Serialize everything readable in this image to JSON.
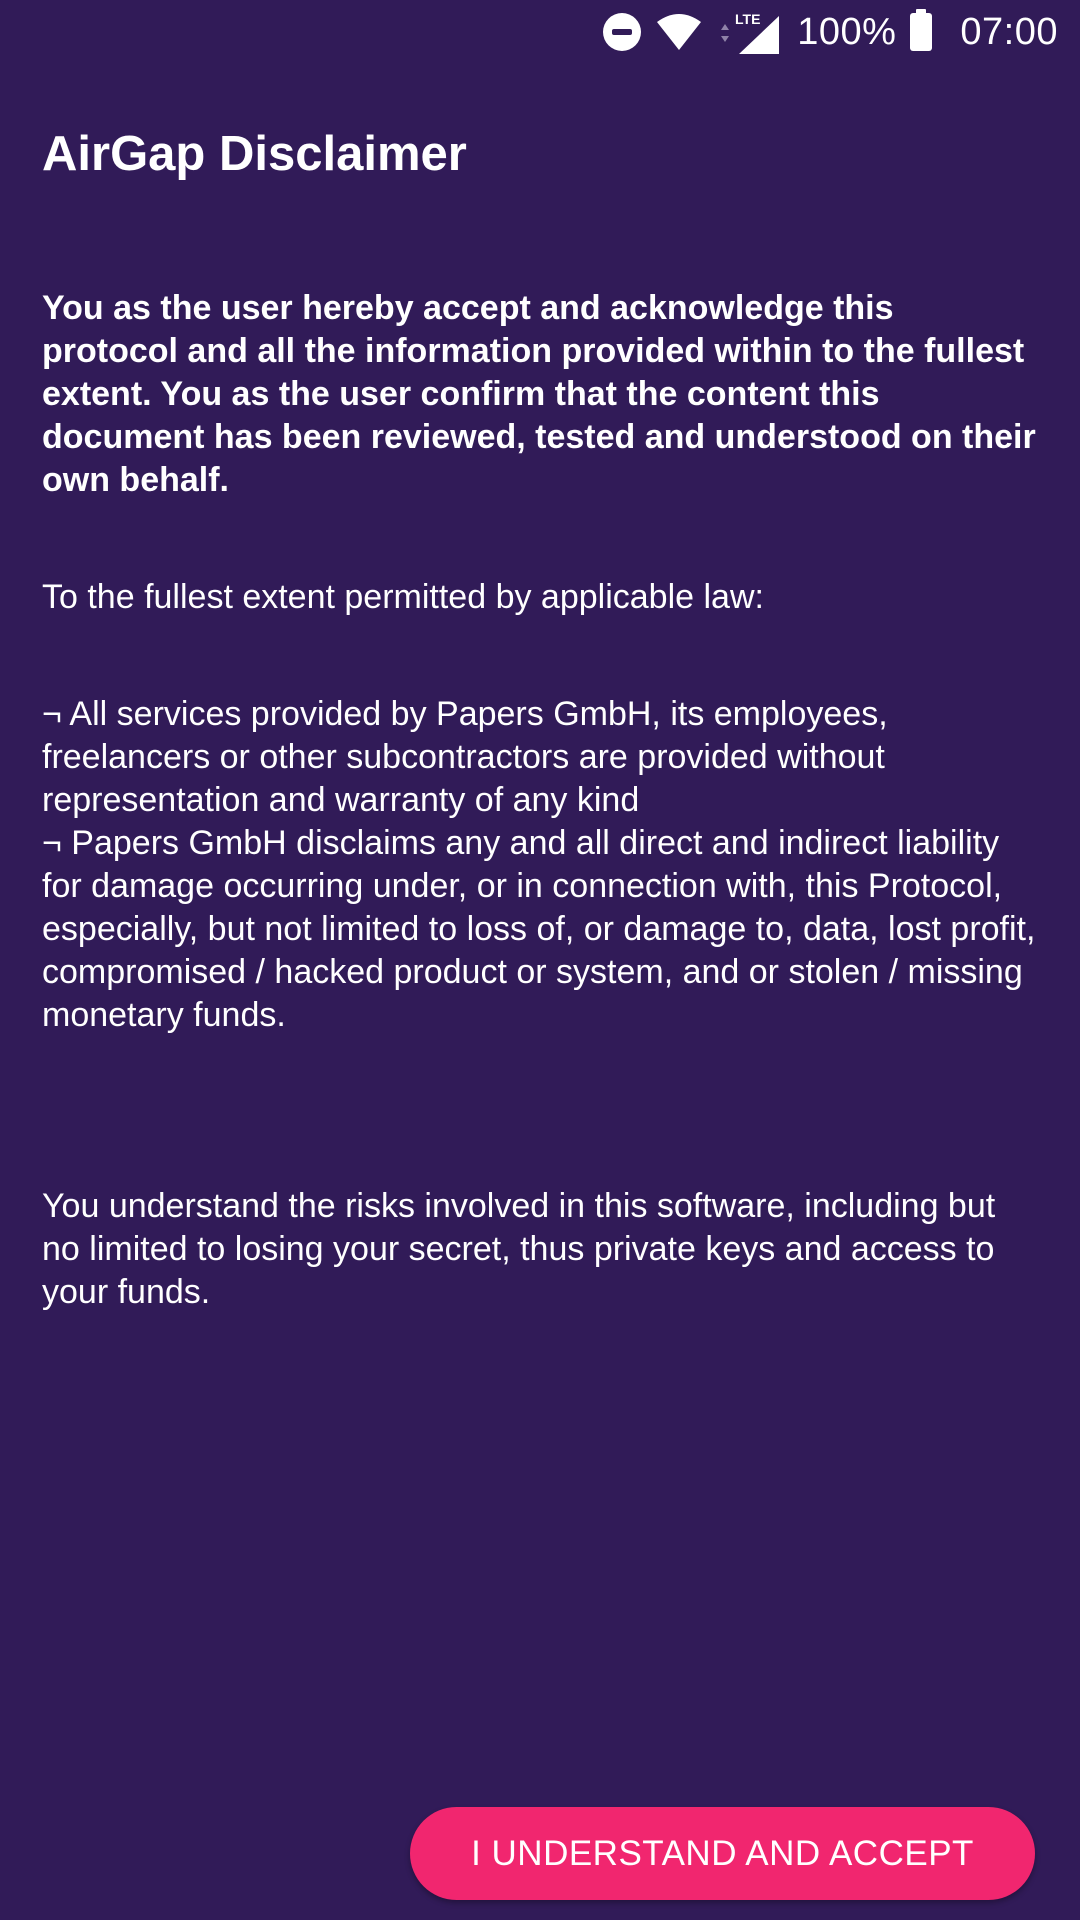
{
  "status_bar": {
    "battery": "100%",
    "time": "07:00",
    "network": "LTE",
    "icons": [
      "do-not-disturb-icon",
      "wifi-icon",
      "lte-signal-icon",
      "battery-icon"
    ]
  },
  "title": "AirGap Disclaimer",
  "intro": "You as the user hereby accept and acknowledge this protocol and all the information provided within to the fullest extent. You as the user confirm that the content this document has been reviewed, tested and understood on their own behalf.",
  "law_heading": "To the fullest extent permitted by applicable law:",
  "bullets": [
    "¬ All services provided by Papers GmbH, its employees, freelancers or other subcontractors are provided without representation and warranty of any kind",
    "¬ Papers GmbH disclaims any and all direct and indirect liability for damage occurring under, or in connection with, this Protocol, especially, but not limited to loss of, or damage to, data, lost profit, compromised / hacked product or system, and or stolen / missing monetary funds."
  ],
  "risk_text": "You understand the risks involved in this software, including but no limited to losing your secret, thus private keys and access to your funds.",
  "accept_button": "I UNDERSTAND AND ACCEPT",
  "colors": {
    "background": "#311b58",
    "accent": "#f1266f",
    "text": "#ffffff"
  }
}
